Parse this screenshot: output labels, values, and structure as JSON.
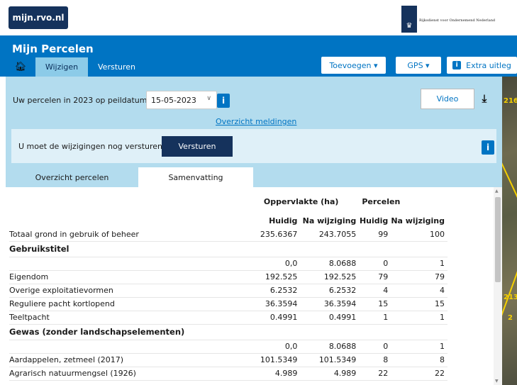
{
  "topbar": {
    "brand": "mijn.rvo.nl",
    "rvo_name": "Rijksdienst voor Ondernemend Nederland"
  },
  "header": {
    "title": "Mijn Percelen",
    "tabs": [
      {
        "label": "Wijzigen"
      },
      {
        "label": "Versturen"
      }
    ],
    "buttons": {
      "toevoegen": "Toevoegen ▾",
      "gps": "GPS ▾",
      "extra_uitleg": "Extra uitleg"
    }
  },
  "panel": {
    "label": "Uw percelen in 2023 op peildatum:",
    "date": "15-05-2023",
    "video": "Video",
    "overzicht_link": "Overzicht meldingen",
    "notice_text": "U moet de wijzigingen nog versturen",
    "versturen": "Versturen"
  },
  "subtabs": [
    {
      "label": "Overzicht percelen"
    },
    {
      "label": "Samenvatting"
    }
  ],
  "table": {
    "group_headers": {
      "oppervlakte": "Oppervlakte (ha)",
      "percelen": "Percelen"
    },
    "col_headers": [
      "Huidig",
      "Na wijziging",
      "Huidig",
      "Na wijziging"
    ],
    "totaal": {
      "label": "Totaal grond in gebruik of beheer",
      "v": [
        "235.6367",
        "243.7055",
        "99",
        "100"
      ]
    },
    "sections": [
      {
        "title": "Gebruikstitel",
        "rows": [
          {
            "label": "",
            "v": [
              "0,0",
              "8.0688",
              "0",
              "1"
            ]
          },
          {
            "label": "Eigendom",
            "v": [
              "192.525",
              "192.525",
              "79",
              "79"
            ]
          },
          {
            "label": "Overige exploitatievormen",
            "v": [
              "6.2532",
              "6.2532",
              "4",
              "4"
            ]
          },
          {
            "label": "Reguliere pacht kortlopend",
            "v": [
              "36.3594",
              "36.3594",
              "15",
              "15"
            ]
          },
          {
            "label": "Teeltpacht",
            "v": [
              "0.4991",
              "0.4991",
              "1",
              "1"
            ]
          }
        ]
      },
      {
        "title": "Gewas (zonder landschapselementen)",
        "rows": [
          {
            "label": "",
            "v": [
              "0,0",
              "8.0688",
              "0",
              "1"
            ]
          },
          {
            "label": "Aardappelen, zetmeel (2017)",
            "v": [
              "101.5349",
              "101.5349",
              "8",
              "8"
            ]
          },
          {
            "label": "Agrarisch natuurmengsel (1926)",
            "v": [
              "4.989",
              "4.989",
              "22",
              "22"
            ]
          }
        ]
      }
    ]
  },
  "map": {
    "labels": [
      "216",
      "213",
      "2"
    ]
  },
  "colors": {
    "brand_dark": "#15325c",
    "header_blue": "#0074c3",
    "panel_blue": "#b3dcee"
  },
  "icons": [
    "home-icon",
    "info-icon",
    "download-icon",
    "chevron-down-icon"
  ]
}
